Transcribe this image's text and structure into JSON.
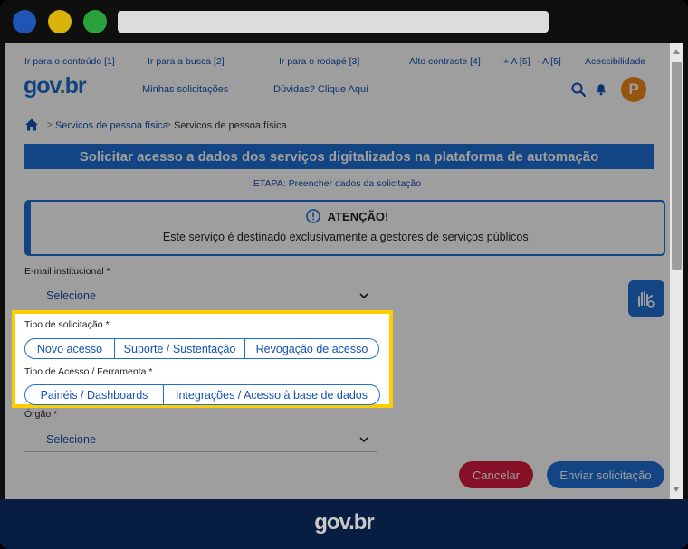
{
  "toplinks": [
    {
      "label": "Ir para o conteúdo [1]"
    },
    {
      "label": "Ir para a busca [2]"
    },
    {
      "label": "Ir para o rodapé [3]"
    },
    {
      "label": "Alto contraste [4]"
    },
    {
      "label": "+ A [5]"
    },
    {
      "label": "- A [5]"
    },
    {
      "label": "Acessibilidade"
    }
  ],
  "logo": {
    "part1": "go",
    "part2": "v",
    "dot": ".",
    "part3": "br"
  },
  "nav": {
    "requests": "Minhas solicitações",
    "help": "Dúvidas? Clique Aqui"
  },
  "avatar": {
    "initial": "P"
  },
  "breadcrumb": {
    "crumb1": "Servicos de pessoa física",
    "crumb2": "Servicos de pessoa física"
  },
  "page": {
    "title": "Solicitar acesso a dados dos serviços digitalizados na plataforma de automação",
    "step": "ETAPA: Preencher dados da solicitação"
  },
  "alert": {
    "title": "ATENÇÃO!",
    "text": "Este serviço é destinado exclusivamente a gestores de serviços públicos."
  },
  "form": {
    "email_label": "E-mail institucional *",
    "email_value": "Selecione",
    "request_type_label": "Tipo de solicitação *",
    "request_types": [
      "Novo acesso",
      "Suporte / Sustentação",
      "Revogação de acesso"
    ],
    "access_type_label": "Tipo de Acesso / Ferramenta *",
    "access_types": [
      "Painéis / Dashboards",
      "Integrações / Acesso à base de dados"
    ],
    "org_label": "Órgão *",
    "org_value": "Selecione"
  },
  "buttons": {
    "cancel": "Cancelar",
    "submit": "Enviar solicitação"
  },
  "footer": {
    "logo": "gov.br"
  },
  "colors": {
    "primary": "#1f6ed4",
    "link": "#1451b4",
    "highlight": "#ffcc00",
    "cancel": "#d81b3c",
    "avatar": "#f08a16",
    "footer": "#071d41"
  }
}
